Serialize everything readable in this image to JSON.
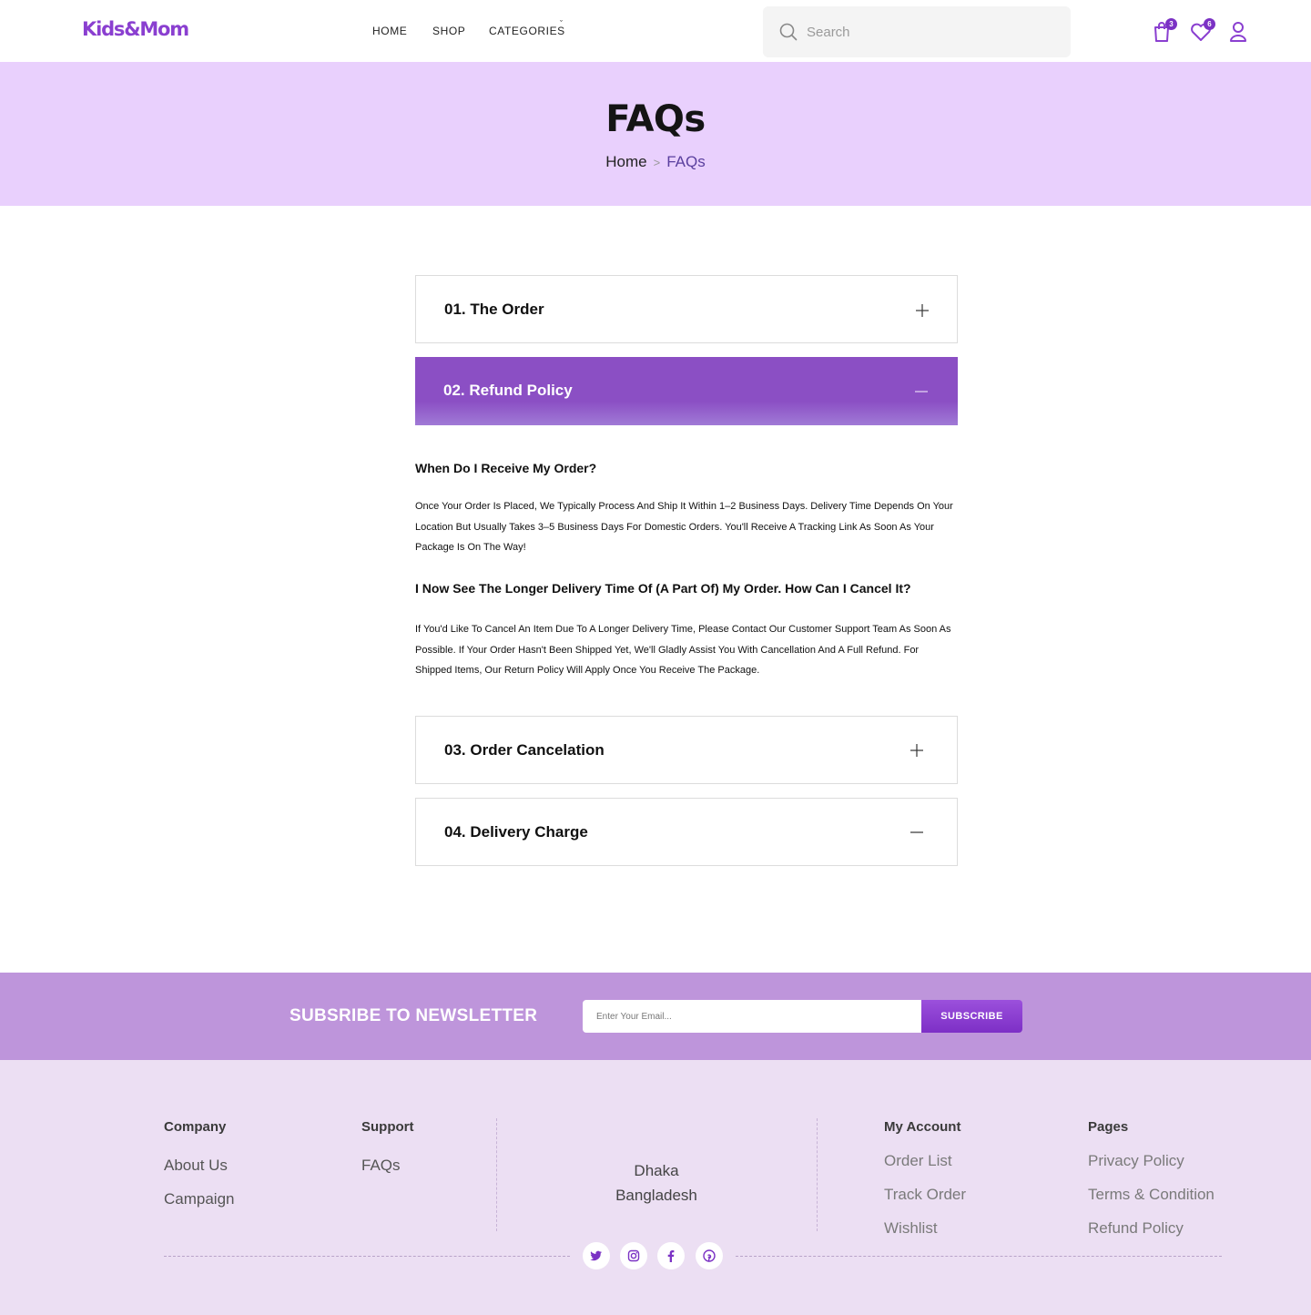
{
  "header": {
    "logo": "Kids&Mom",
    "nav": [
      "HOME",
      "SHOP",
      "CATEGORIES"
    ],
    "search_placeholder": "Search",
    "cart_count": "3",
    "wishlist_count": "6"
  },
  "hero": {
    "title": "FAQs",
    "breadcrumb_home": "Home",
    "breadcrumb_separator": ">",
    "breadcrumb_current": "FAQs"
  },
  "faq": {
    "items": [
      {
        "title": "01. The Order",
        "state": "collapsed"
      },
      {
        "title": "02. Refund Policy",
        "state": "expanded"
      },
      {
        "title": "03. Order Cancelation",
        "state": "collapsed"
      },
      {
        "title": "04. Delivery Charge",
        "state": "collapsed"
      }
    ],
    "qa": [
      {
        "q": "When Do I Receive My Order?",
        "a": "Once Your Order Is Placed, We Typically Process And Ship It Within 1–2 Business Days. Delivery Time Depends On Your Location But Usually Takes 3–5 Business Days For Domestic Orders. You'll Receive A Tracking Link As Soon As Your Package Is On The Way!"
      },
      {
        "q": "I Now See The Longer Delivery Time Of (A Part Of) My Order. How Can I Cancel It?",
        "a": "If You'd Like To Cancel An Item Due To A Longer Delivery Time, Please Contact Our Customer Support Team As Soon As Possible. If Your Order Hasn't Been Shipped Yet, We'll Gladly Assist You With Cancellation And A Full Refund. For Shipped Items, Our Return Policy Will Apply Once You Receive The Package."
      }
    ]
  },
  "newsletter": {
    "title": "SUBSRIBE TO NEWSLETTER",
    "email_placeholder": "Enter Your Email...",
    "button": "SUBSCRIBE"
  },
  "footer": {
    "company": {
      "heading": "Company",
      "links": [
        "About Us",
        "Campaign"
      ]
    },
    "support": {
      "heading": "Support",
      "links": [
        "FAQs"
      ]
    },
    "address": [
      "Dhaka",
      "Bangladesh"
    ],
    "account": {
      "heading": "My Account",
      "links": [
        "Order List",
        "Track Order",
        "Wishlist"
      ]
    },
    "pages": {
      "heading": "Pages",
      "links": [
        "Privacy Policy",
        "Terms & Condition",
        "Refund Policy"
      ]
    },
    "social": [
      "twitter-icon",
      "instagram-icon",
      "facebook-icon",
      "pinterest-icon"
    ]
  },
  "colors": {
    "brand": "#8a3fd0",
    "hero_bg": "#e9d0fd",
    "active_accordion": "#8b4fc4",
    "newsletter_bg": "#be95db",
    "footer_bg": "#ecdff3"
  }
}
